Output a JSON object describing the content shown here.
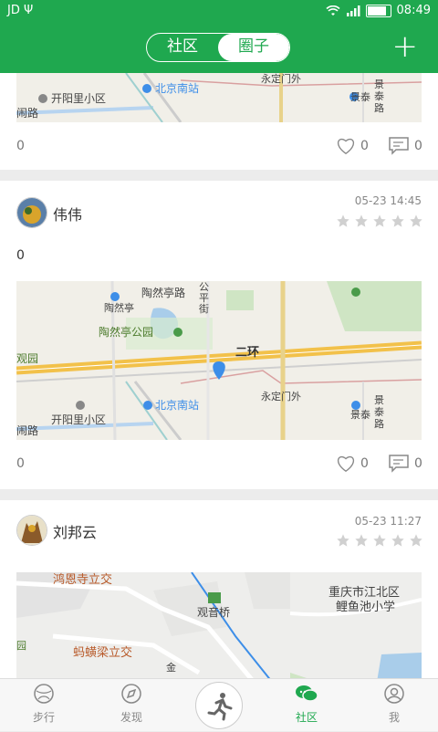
{
  "status": {
    "carrier": "JD Ψ",
    "time": "08:49"
  },
  "header": {
    "tabs": [
      "社区",
      "圈子"
    ],
    "add_icon": "plus-icon"
  },
  "map_labels": {
    "taoranting_road": "陶然亭路",
    "taoranting": "陶然亭",
    "taoranting_park": "陶然亭公园",
    "street_a": "公",
    "street_b": "平",
    "street_c": "街",
    "park_left": "观园",
    "second_ring": "二环",
    "yongdingmen": "永定门外",
    "beijing_south": "北京南站",
    "kaiyangli": "开阳里小区",
    "road_left": "闹路",
    "jingtai": "景泰",
    "jing": "景",
    "tai": "泰",
    "lu": "路",
    "hongen": "鸿恩寺立交",
    "chongqing": "重庆市江北区",
    "liyuchi": "鲤鱼池小学",
    "guanyinqiao": "观音桥",
    "mayi": "蚂蟥梁立交",
    "yuan": "园",
    "jin": "金"
  },
  "posts": [
    {
      "content": "0",
      "likes": "0",
      "comments": "0"
    },
    {
      "user": "伟伟",
      "time": "05-23 14:45",
      "content": "0",
      "likes": "0",
      "comments": "0"
    },
    {
      "user": "刘邦云",
      "time": "05-23 11:27"
    }
  ],
  "nav": {
    "items": [
      "步行",
      "发现",
      "社区",
      "我"
    ],
    "active": "社区"
  },
  "colors": {
    "brand": "#1fa84f",
    "star": "#d0d0d0",
    "pin": "#3d8ee8"
  }
}
